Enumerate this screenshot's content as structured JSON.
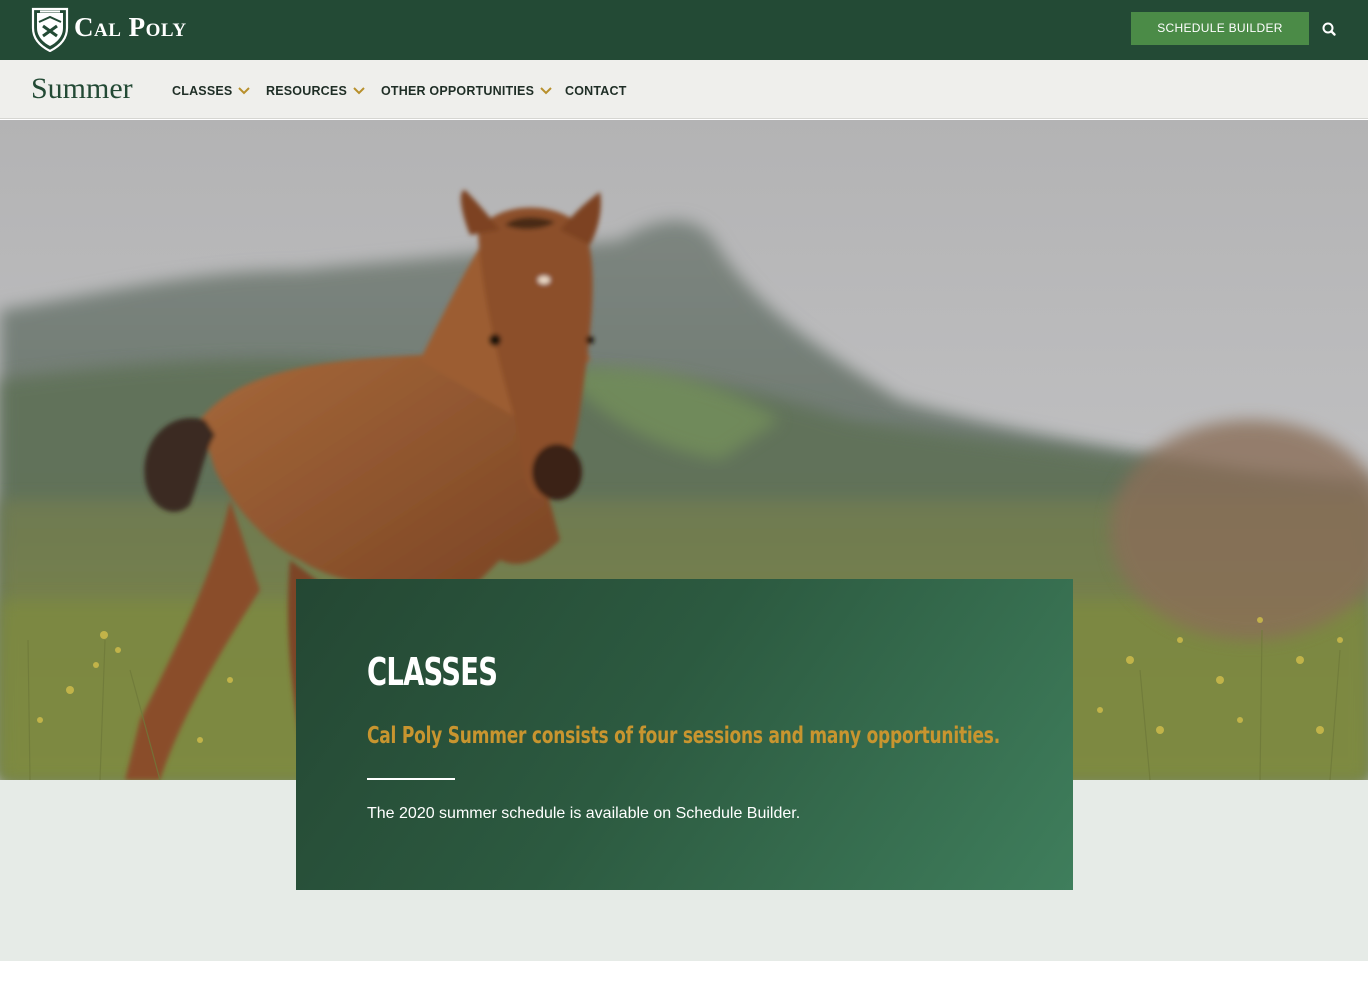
{
  "header": {
    "brand": "Cal Poly",
    "logo_icon": "cal-poly-shield-logo",
    "schedule_button_label": "SCHEDULE BUILDER",
    "search_icon": "search-icon"
  },
  "subnav": {
    "site_title": "Summer",
    "items": [
      {
        "label": "CLASSES",
        "has_dropdown": true
      },
      {
        "label": "RESOURCES",
        "has_dropdown": true
      },
      {
        "label": "OTHER OPPORTUNITIES",
        "has_dropdown": true
      },
      {
        "label": "CONTACT",
        "has_dropdown": false
      }
    ]
  },
  "hero": {
    "image": "photo of a brown foal in a grassy meadow with mountains behind"
  },
  "card": {
    "heading": "CLASSES",
    "subtitle": "Cal Poly Summer consists of four sessions and many opportunities.",
    "body": "The 2020 summer schedule is available on Schedule Builder."
  },
  "colors": {
    "header_bg": "#234a35",
    "nav_bg": "#efefec",
    "button_green": "#4b8b47",
    "gold_accent": "#c8952f",
    "card_green": "#2c5a40"
  }
}
